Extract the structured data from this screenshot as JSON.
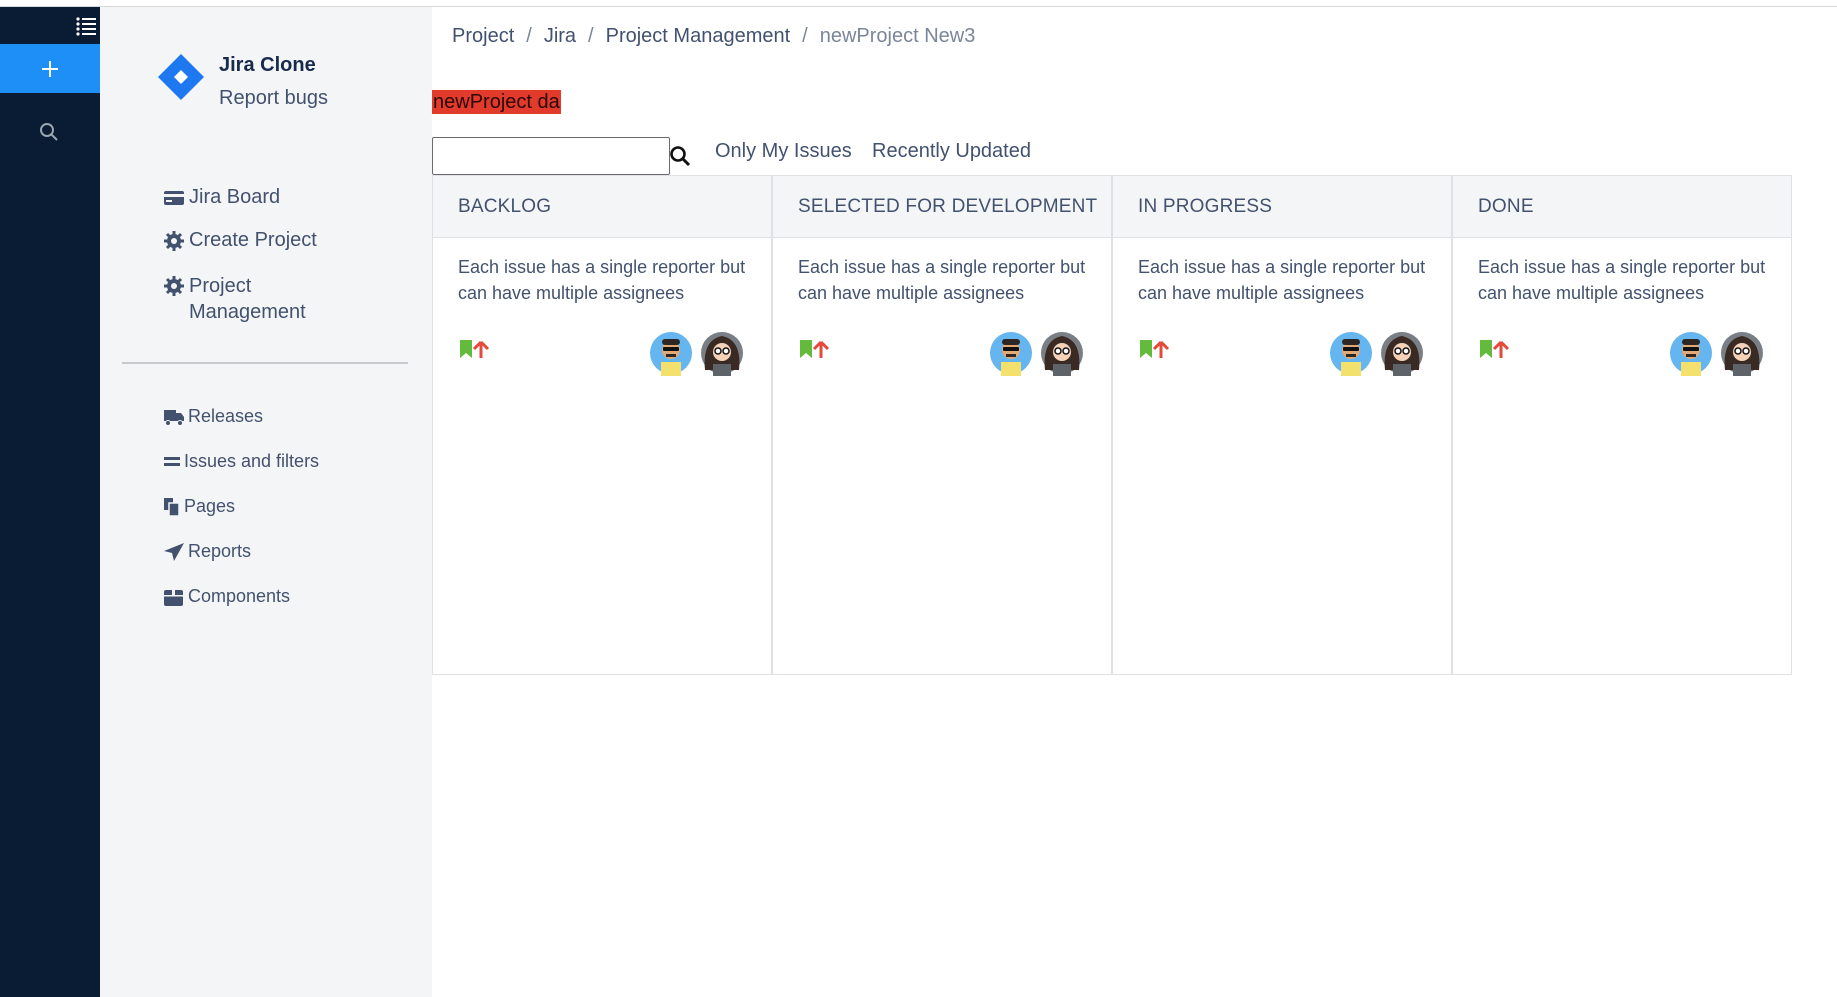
{
  "rail": {
    "menu_icon": "list-icon",
    "create_icon": "plus-icon",
    "search_icon": "search-icon",
    "accent": "#1e8ff6",
    "bg": "#0a1c33"
  },
  "sidebar": {
    "app_name": "Jira Clone",
    "app_subtitle": "Report bugs",
    "items": [
      {
        "label": "Jira Board",
        "icon": "credit-card-icon"
      },
      {
        "label": "Create Project",
        "icon": "gear-icon"
      },
      {
        "label": "Project Management",
        "icon": "gear-icon"
      }
    ],
    "secondary_items": [
      {
        "label": "Releases",
        "icon": "truck-icon"
      },
      {
        "label": "Issues and filters",
        "icon": "equals-icon"
      },
      {
        "label": "Pages",
        "icon": "copy-icon"
      },
      {
        "label": "Reports",
        "icon": "paper-plane-icon"
      },
      {
        "label": "Components",
        "icon": "box-icon"
      }
    ]
  },
  "breadcrumb": [
    "Project",
    "Jira",
    "Project Management",
    "newProject New3"
  ],
  "project_title": "newProject da",
  "filters": {
    "search_value": "",
    "only_my_issues": "Only My Issues",
    "recently_updated": "Recently Updated"
  },
  "columns": [
    {
      "title": "BACKLOG",
      "card": {
        "text": "Each issue has a single reporter but can have multiple assignees"
      }
    },
    {
      "title": "SELECTED FOR DEVELOPMENT",
      "card": {
        "text": "Each issue has a single reporter but can have multiple assignees"
      }
    },
    {
      "title": "IN PROGRESS",
      "card": {
        "text": "Each issue has a single reporter but can have multiple assignees"
      }
    },
    {
      "title": "DONE",
      "card": {
        "text": "Each issue has a single reporter but can have multiple assignees"
      }
    }
  ],
  "colors": {
    "title_highlight": "#e23a2b",
    "story_icon": "#63ba3c",
    "priority_icon": "#e5493a"
  }
}
